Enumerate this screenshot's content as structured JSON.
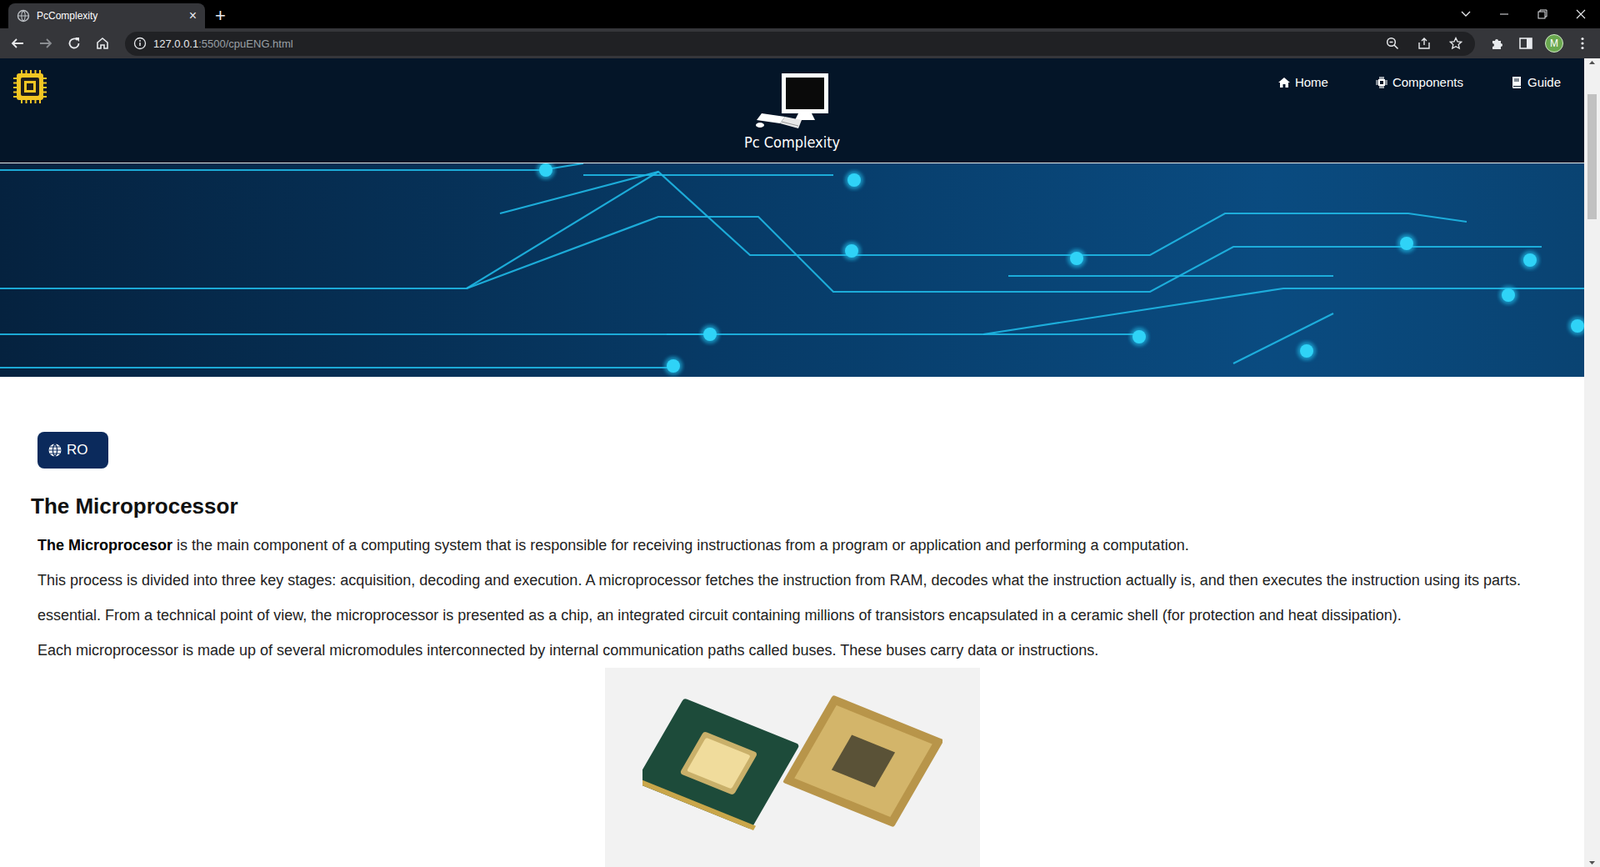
{
  "browser": {
    "tabs": [
      {
        "title": "PcComplexity",
        "close": "×",
        "selected": true
      }
    ],
    "new_tab": "+",
    "address": {
      "host": "127.0.0.1",
      "path": ":5500/cpuENG.html"
    },
    "profile_initial": "M"
  },
  "header": {
    "brand": "Pc Complexity",
    "nav": [
      {
        "label": "Home"
      },
      {
        "label": "Components"
      },
      {
        "label": "Guide"
      }
    ]
  },
  "language_button": "RO",
  "article": {
    "title": "The Microprocessor",
    "lines": [
      {
        "bold": "The Microprocesor",
        "text": " is the main component of a computing system that is responsible for receiving instructionas from a program or application and performing a computation."
      },
      {
        "bold": "",
        "text": "This process is divided into three key stages: acquisition, decoding and execution. A microprocessor fetches the instruction from RAM, decodes what the instruction actually is, and then executes the instruction using its parts."
      },
      {
        "bold": "",
        "text": "essential. From a technical point of view, the microprocessor is presented as a chip, an integrated circuit containing millions of transistors encapsulated in a ceramic shell (for protection and heat dissipation)."
      },
      {
        "bold": "",
        "text": "Each microprocessor is made up of several micromodules interconnected by internal communication paths called buses. These buses carry data or instructions."
      }
    ]
  }
}
